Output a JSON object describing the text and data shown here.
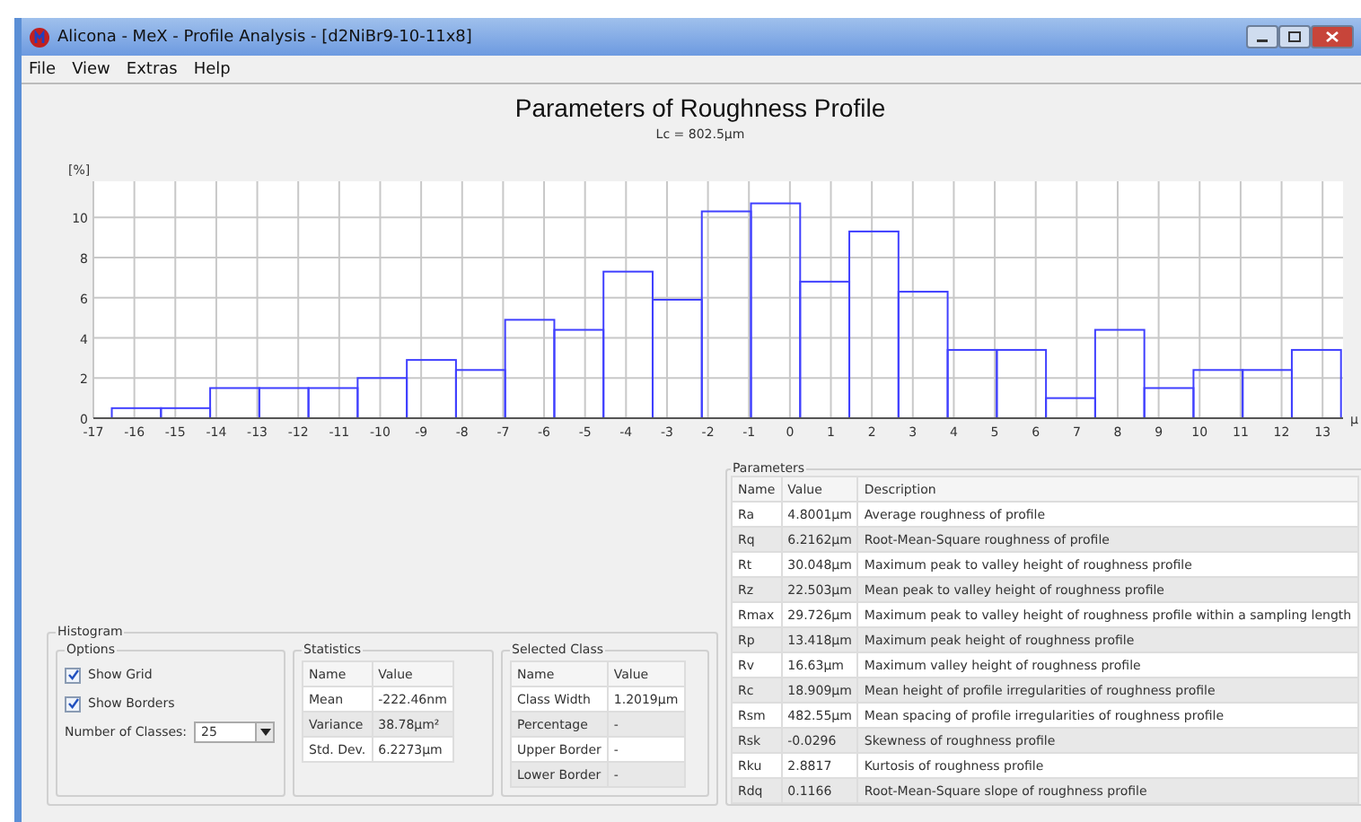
{
  "window": {
    "title": "Alicona - MeX - Profile Analysis - [d2NiBr9-10-11x8]"
  },
  "menu": [
    "File",
    "View",
    "Extras",
    "Help"
  ],
  "chart": {
    "title": "Parameters of Roughness Profile",
    "subtitle": "Lc = 802.5µm",
    "chart_data": {
      "type": "bar",
      "ylabel": "[%]",
      "xlabel": "µ",
      "x": [
        -15.95,
        -14.75,
        -13.55,
        -12.35,
        -11.15,
        -9.95,
        -8.75,
        -7.55,
        -6.35,
        -5.15,
        -3.95,
        -2.75,
        -1.55,
        -0.35,
        0.85,
        2.05,
        3.25,
        4.45,
        5.65,
        6.85,
        8.05,
        9.25,
        10.45,
        11.65,
        12.85
      ],
      "values": [
        0.5,
        0.5,
        1.5,
        1.5,
        1.5,
        2,
        2.9,
        2.4,
        4.9,
        4.4,
        7.3,
        5.9,
        10.3,
        10.7,
        6.8,
        9.3,
        6.3,
        3.4,
        3.4,
        1,
        4.4,
        1.5,
        2.4,
        2.4,
        3.4
      ],
      "xlim": [
        -17,
        13.5
      ],
      "ylim": [
        0,
        11.8
      ],
      "xticks": [
        -17,
        -16,
        -15,
        -14,
        -13,
        -12,
        -11,
        -10,
        -9,
        -8,
        -7,
        -6,
        -5,
        -4,
        -3,
        -2,
        -1,
        0,
        1,
        2,
        3,
        4,
        5,
        6,
        7,
        8,
        9,
        10,
        11,
        12,
        13
      ],
      "yticks": [
        0,
        2,
        4,
        6,
        8,
        10
      ],
      "grid": true
    }
  },
  "histogram": {
    "title": "Histogram",
    "options": {
      "title": "Options",
      "checkboxes": [
        {
          "label": "Show Grid",
          "checked": true
        },
        {
          "label": "Show Borders",
          "checked": true
        }
      ],
      "classes_label": "Number of Classes:",
      "classes_value": "25"
    },
    "statistics": {
      "title": "Statistics",
      "columns": [
        "Name",
        "Value"
      ],
      "rows": [
        [
          "Mean",
          "-222.46nm"
        ],
        [
          "Variance",
          "38.78µm²"
        ],
        [
          "Std. Dev.",
          "6.2273µm"
        ]
      ]
    },
    "selected_class": {
      "title": "Selected Class",
      "columns": [
        "Name",
        "Value"
      ],
      "rows": [
        [
          "Class Width",
          "1.2019µm"
        ],
        [
          "Percentage",
          "-"
        ],
        [
          "Upper Border",
          "-"
        ],
        [
          "Lower Border",
          "-"
        ]
      ]
    }
  },
  "parameters": {
    "title": "Parameters",
    "columns": [
      "Name",
      "Value",
      "Description"
    ],
    "rows": [
      [
        "Ra",
        "4.8001µm",
        "Average roughness of profile"
      ],
      [
        "Rq",
        "6.2162µm",
        "Root-Mean-Square roughness of profile"
      ],
      [
        "Rt",
        "30.048µm",
        "Maximum peak to valley height of roughness profile"
      ],
      [
        "Rz",
        "22.503µm",
        "Mean peak to valley height of roughness profile"
      ],
      [
        "Rmax",
        "29.726µm",
        "Maximum peak to valley height of roughness profile within a sampling length"
      ],
      [
        "Rp",
        "13.418µm",
        "Maximum peak height of roughness profile"
      ],
      [
        "Rv",
        "16.63µm",
        "Maximum valley height of roughness profile"
      ],
      [
        "Rc",
        "18.909µm",
        "Mean height of profile irregularities of roughness profile"
      ],
      [
        "Rsm",
        "482.55µm",
        "Mean spacing of profile irregularities of roughness profile"
      ],
      [
        "Rsk",
        "-0.0296",
        "Skewness of roughness profile"
      ],
      [
        "Rku",
        "2.8817",
        "Kurtosis of roughness profile"
      ],
      [
        "Rdq",
        "0.1166",
        "Root-Mean-Square slope of roughness profile"
      ]
    ]
  }
}
